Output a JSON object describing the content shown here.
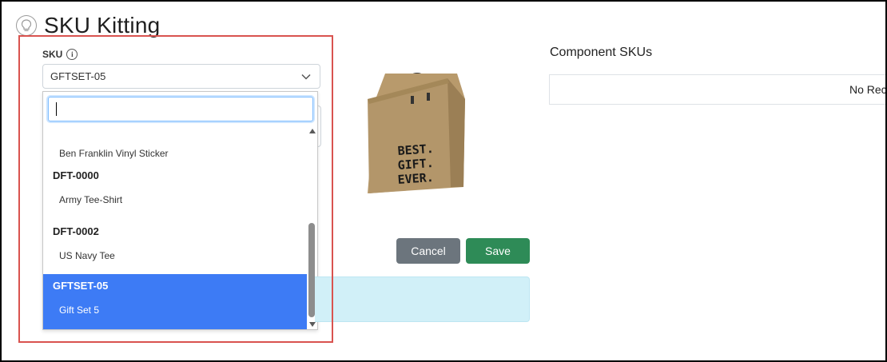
{
  "page": {
    "title": "SKU Kitting"
  },
  "sku_field": {
    "label": "SKU",
    "selected_value": "GFTSET-05"
  },
  "dropdown": {
    "search_value": "",
    "options": [
      {
        "sku": "",
        "name": "Ben Franklin Vinyl Sticker"
      },
      {
        "sku": "DFT-0000",
        "name": "Army Tee-Shirt"
      },
      {
        "sku": "DFT-0002",
        "name": "US Navy Tee"
      },
      {
        "sku": "GFTSET-05",
        "name": "Gift Set 5",
        "selected": true
      }
    ]
  },
  "product_image": {
    "alt": "gift bag",
    "text_lines": [
      "BEST.",
      "GIFT.",
      "EVER."
    ]
  },
  "actions": {
    "cancel_label": "Cancel",
    "save_label": "Save"
  },
  "components": {
    "title": "Component SKUs",
    "empty_text": "No Reco"
  },
  "colors": {
    "selected_option": "#3d7bf5",
    "save_button": "#2e8b57",
    "cancel_button": "#6c757d",
    "info_alert": "#d1f0f8",
    "highlight": "#d9534f"
  }
}
